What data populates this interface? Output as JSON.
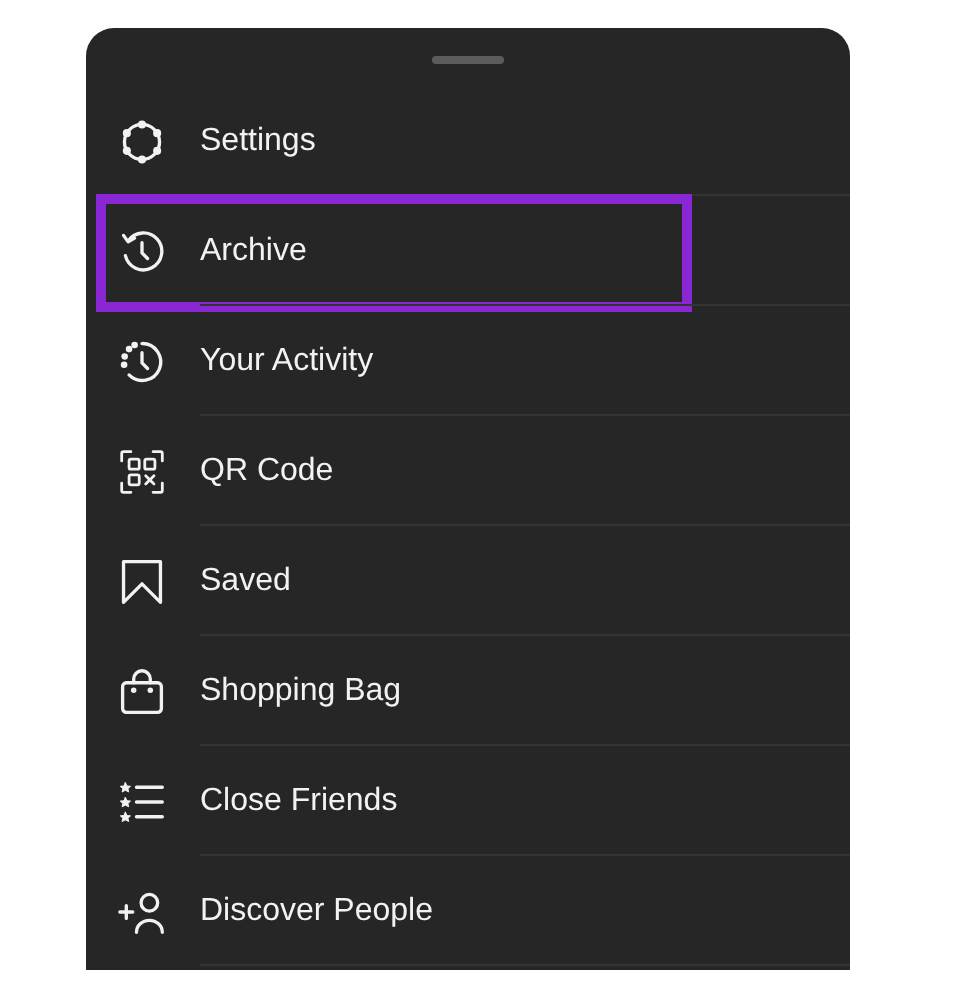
{
  "menu": {
    "items": [
      {
        "kind": "settings",
        "label": "Settings",
        "highlighted": false
      },
      {
        "kind": "archive",
        "label": "Archive",
        "highlighted": true
      },
      {
        "kind": "activity",
        "label": "Your Activity",
        "highlighted": false
      },
      {
        "kind": "qr",
        "label": "QR Code",
        "highlighted": false
      },
      {
        "kind": "saved",
        "label": "Saved",
        "highlighted": false
      },
      {
        "kind": "bag",
        "label": "Shopping Bag",
        "highlighted": false
      },
      {
        "kind": "friends",
        "label": "Close Friends",
        "highlighted": false
      },
      {
        "kind": "discover",
        "label": "Discover People",
        "highlighted": false
      }
    ]
  }
}
